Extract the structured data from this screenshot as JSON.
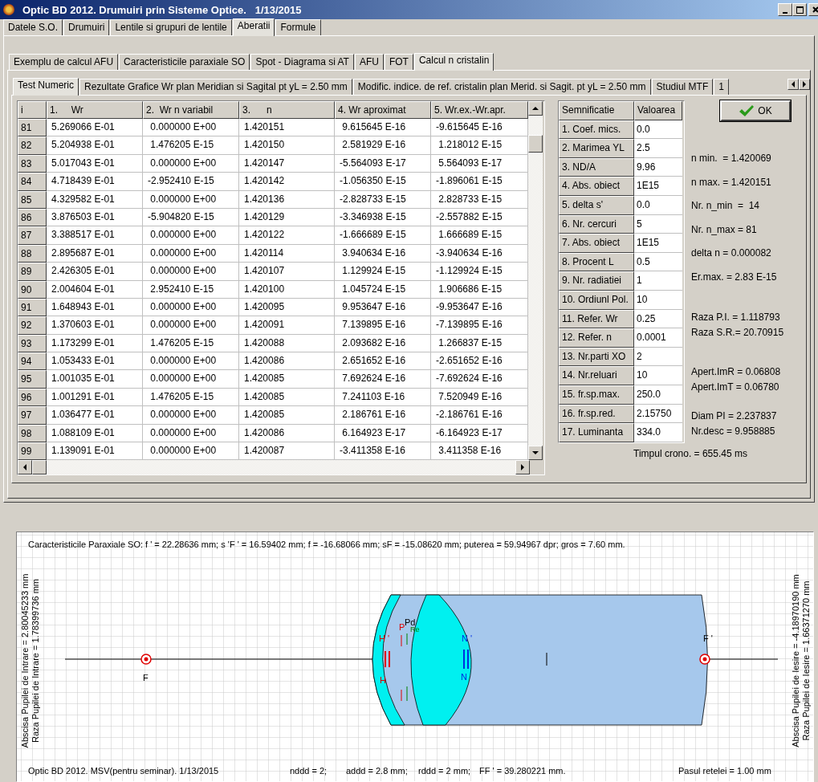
{
  "window": {
    "title": "Optic BD 2012. Drumuiri prin Sisteme Optice.   1/13/2015"
  },
  "tabs": [
    {
      "label": "Datele S.O.",
      "selected": false
    },
    {
      "label": "Drumuiri",
      "selected": false
    },
    {
      "label": "Lentile si grupuri de lentile",
      "selected": false
    },
    {
      "label": "Aberatii",
      "selected": true
    },
    {
      "label": "Formule",
      "selected": false
    }
  ],
  "subtabs": [
    {
      "label": "Exemplu de calcul AFU",
      "selected": false
    },
    {
      "label": "Caracteristicile paraxiale SO",
      "selected": false
    },
    {
      "label": "Spot - Diagrama si AT",
      "selected": false
    },
    {
      "label": "AFU",
      "selected": false
    },
    {
      "label": "FOT",
      "selected": false
    },
    {
      "label": "Calcul n cristalin",
      "selected": true
    }
  ],
  "inner_tabs": [
    {
      "label": "Test Numeric",
      "selected": true
    },
    {
      "label": "Rezultate Grafice Wr plan Meridian si Sagital pt yL = 2.50 mm",
      "selected": false
    },
    {
      "label": "Modific. indice. de ref. cristalin plan Merid. si Sagit. pt yL = 2.50 mm",
      "selected": false
    },
    {
      "label": "Studiul MTF",
      "selected": false
    },
    {
      "label": "1",
      "selected": false
    }
  ],
  "table": {
    "columns": [
      "i",
      "1.     Wr",
      "2.  Wr n variabil",
      "3.      n",
      "4. Wr aproximat",
      "5. Wr.ex.-Wr.apr."
    ],
    "rows": [
      [
        "81",
        "5.269066 E-01",
        " 0.000000 E+00",
        "1.420151",
        " 9.615645 E-16",
        "-9.615645 E-16"
      ],
      [
        "82",
        "5.204938 E-01",
        " 1.476205 E-15",
        "1.420150",
        " 2.581929 E-16",
        " 1.218012 E-15"
      ],
      [
        "83",
        "5.017043 E-01",
        " 0.000000 E+00",
        "1.420147",
        "-5.564093 E-17",
        " 5.564093 E-17"
      ],
      [
        "84",
        "4.718439 E-01",
        "-2.952410 E-15",
        "1.420142",
        "-1.056350 E-15",
        "-1.896061 E-15"
      ],
      [
        "85",
        "4.329582 E-01",
        " 0.000000 E+00",
        "1.420136",
        "-2.828733 E-15",
        " 2.828733 E-15"
      ],
      [
        "86",
        "3.876503 E-01",
        "-5.904820 E-15",
        "1.420129",
        "-3.346938 E-15",
        "-2.557882 E-15"
      ],
      [
        "87",
        "3.388517 E-01",
        " 0.000000 E+00",
        "1.420122",
        "-1.666689 E-15",
        " 1.666689 E-15"
      ],
      [
        "88",
        "2.895687 E-01",
        " 0.000000 E+00",
        "1.420114",
        " 3.940634 E-16",
        "-3.940634 E-16"
      ],
      [
        "89",
        "2.426305 E-01",
        " 0.000000 E+00",
        "1.420107",
        " 1.129924 E-15",
        "-1.129924 E-15"
      ],
      [
        "90",
        "2.004604 E-01",
        " 2.952410 E-15",
        "1.420100",
        " 1.045724 E-15",
        " 1.906686 E-15"
      ],
      [
        "91",
        "1.648943 E-01",
        " 0.000000 E+00",
        "1.420095",
        " 9.953647 E-16",
        "-9.953647 E-16"
      ],
      [
        "92",
        "1.370603 E-01",
        " 0.000000 E+00",
        "1.420091",
        " 7.139895 E-16",
        "-7.139895 E-16"
      ],
      [
        "93",
        "1.173299 E-01",
        " 1.476205 E-15",
        "1.420088",
        " 2.093682 E-16",
        " 1.266837 E-15"
      ],
      [
        "94",
        "1.053433 E-01",
        " 0.000000 E+00",
        "1.420086",
        " 2.651652 E-16",
        "-2.651652 E-16"
      ],
      [
        "95",
        "1.001035 E-01",
        " 0.000000 E+00",
        "1.420085",
        " 7.692624 E-16",
        "-7.692624 E-16"
      ],
      [
        "96",
        "1.001291 E-01",
        " 1.476205 E-15",
        "1.420085",
        " 7.241103 E-16",
        " 7.520949 E-16"
      ],
      [
        "97",
        "1.036477 E-01",
        " 0.000000 E+00",
        "1.420085",
        " 2.186761 E-16",
        "-2.186761 E-16"
      ],
      [
        "98",
        "1.088109 E-01",
        " 0.000000 E+00",
        "1.420086",
        " 6.164923 E-17",
        "-6.164923 E-17"
      ],
      [
        "99",
        "1.139091 E-01",
        " 0.000000 E+00",
        "1.420087",
        "-3.411358 E-16",
        " 3.411358 E-16"
      ]
    ]
  },
  "params": {
    "columns": [
      "Semnificatie",
      "Valoarea"
    ],
    "rows": [
      {
        "label": "1. Coef. mics.",
        "value": "0.0"
      },
      {
        "label": "2. Marimea YL",
        "value": "2.5"
      },
      {
        "label": "3. ND/A",
        "value": "9.96"
      },
      {
        "label": "4. Abs. obiect",
        "value": "1E15"
      },
      {
        "label": "5. delta s'",
        "value": "0.0"
      },
      {
        "label": "6. Nr. cercuri",
        "value": "5"
      },
      {
        "label": "7. Abs. obiect",
        "value": "1E15"
      },
      {
        "label": "8. Procent L",
        "value": "0.5"
      },
      {
        "label": "9. Nr. radiatiei",
        "value": "1"
      },
      {
        "label": "10. Ordiunl Pol.",
        "value": "10"
      },
      {
        "label": "11. Refer. Wr",
        "value": "0.25"
      },
      {
        "label": "12. Refer. n",
        "value": "0.0001"
      },
      {
        "label": "13. Nr.parti XO",
        "value": "2"
      },
      {
        "label": "14. Nr.reluari",
        "value": "10"
      },
      {
        "label": "15. fr.sp.max.",
        "value": "250.0"
      },
      {
        "label": "16. fr.sp.red.",
        "value": "2.15750"
      },
      {
        "label": "17. Luminanta",
        "value": "334.0"
      }
    ]
  },
  "ok_button": "OK",
  "results": [
    {
      "kind": "spread",
      "lines": [
        "n min.  = 1.420069",
        "n max. = 1.420151",
        "Nr. n_min  =  14",
        "Nr. n_max = 81",
        "delta n = 0.000082",
        "Er.max. = 2.83 E-15"
      ]
    },
    {
      "kind": "tight",
      "lines": [
        "Raza P.I. = 1.118793",
        "Raza S.R.= 20.70915"
      ]
    },
    {
      "kind": "tight",
      "lines": [
        "Apert.ImR = 0.06808",
        "Apert.ImT = 0.06780"
      ]
    },
    {
      "kind": "tight",
      "lines": [
        "Diam PI = 2.237837",
        "Nr.desc = 9.958885"
      ]
    }
  ],
  "timer": "Timpul crono. = 655.45 ms",
  "diagram": {
    "caption": "Caracteristicile Paraxiale SO:  f ' = 22.28636 mm;   s 'F ' = 16.59402 mm;   f = -16.68066 mm;   sF = -15.08620 mm;   puterea = 59.94967 dpr;   gros = 7.60 mm.",
    "left_labels": [
      "Abscisa Pupilei de Intrare = 2.80045233 mm",
      "Raza Pupilei de Intrare = 1.78399736 mm"
    ],
    "right_labels": [
      "Abscisa Pupilei de Iesire = -4.18970190 mm",
      "Raza Pupilei de Iesire = 1.66371270 mm"
    ],
    "points": {
      "F": "F",
      "F_prime": "F '",
      "H": "H",
      "H_prime": "H '",
      "N": "N",
      "N_prime": "N '",
      "P": "P",
      "Pd": "Pd",
      "Re": "Re"
    },
    "footer": [
      "Optic BD 2012. MSV(pentru seminar).  1/13/2015",
      "nddd = 2;",
      "addd = 2.8 mm;",
      "rddd = 2 mm;",
      "FF ' = 39.280221 mm.",
      "Pasul retelei = 1.00 mm"
    ]
  }
}
